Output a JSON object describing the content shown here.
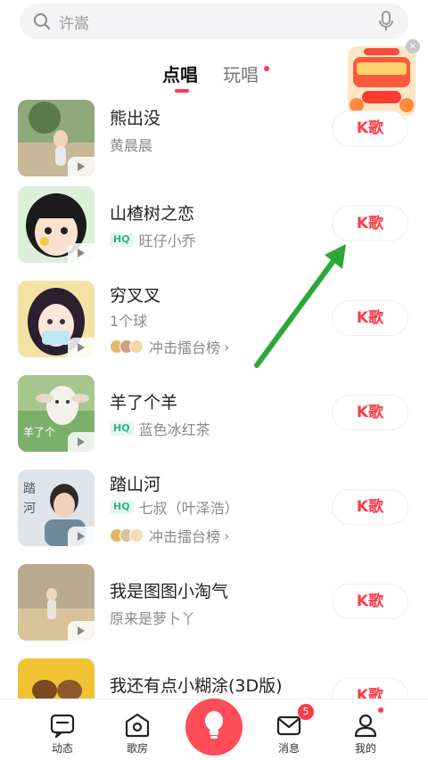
{
  "search": {
    "placeholder": "许嵩"
  },
  "tabs": [
    {
      "label": "点唱",
      "active": true
    },
    {
      "label": "玩唱",
      "active": false,
      "has_dot": true
    }
  ],
  "songs": [
    {
      "title": "熊出没",
      "artist": "黄晨晨",
      "hq": false,
      "rank": "",
      "k_label": "K歌"
    },
    {
      "title": "山楂树之恋",
      "artist": "旺仔小乔",
      "hq": true,
      "rank": "",
      "k_label": "K歌"
    },
    {
      "title": "穷叉叉",
      "artist": "1个球",
      "hq": false,
      "rank": "冲击擂台榜",
      "k_label": "K歌"
    },
    {
      "title": "羊了个羊",
      "artist": "蓝色冰红茶",
      "hq": true,
      "rank": "",
      "k_label": "K歌"
    },
    {
      "title": "踏山河",
      "artist": "七叔（叶泽浩）",
      "hq": true,
      "rank": "冲击擂台榜",
      "k_label": "K歌"
    },
    {
      "title": "我是图图小淘气",
      "artist": "原来是萝卜丫",
      "hq": false,
      "rank": "",
      "k_label": "K歌"
    },
    {
      "title": "我还有点小糊涂(3D版)",
      "artist": "",
      "hq": false,
      "rank": "",
      "k_label": "K歌"
    }
  ],
  "hq_label": "HQ",
  "bottom_nav": [
    {
      "label": "动态",
      "icon": "chat-icon"
    },
    {
      "label": "歌房",
      "icon": "room-icon"
    },
    {
      "label": "",
      "icon": "bulb-icon"
    },
    {
      "label": "消息",
      "icon": "mail-icon",
      "badge": "5"
    },
    {
      "label": "我的",
      "icon": "person-icon",
      "has_dot": true
    }
  ],
  "colors": {
    "accent": "#ff3b49",
    "hq_green": "#2fb58a",
    "arrow_green": "#2aa838"
  }
}
